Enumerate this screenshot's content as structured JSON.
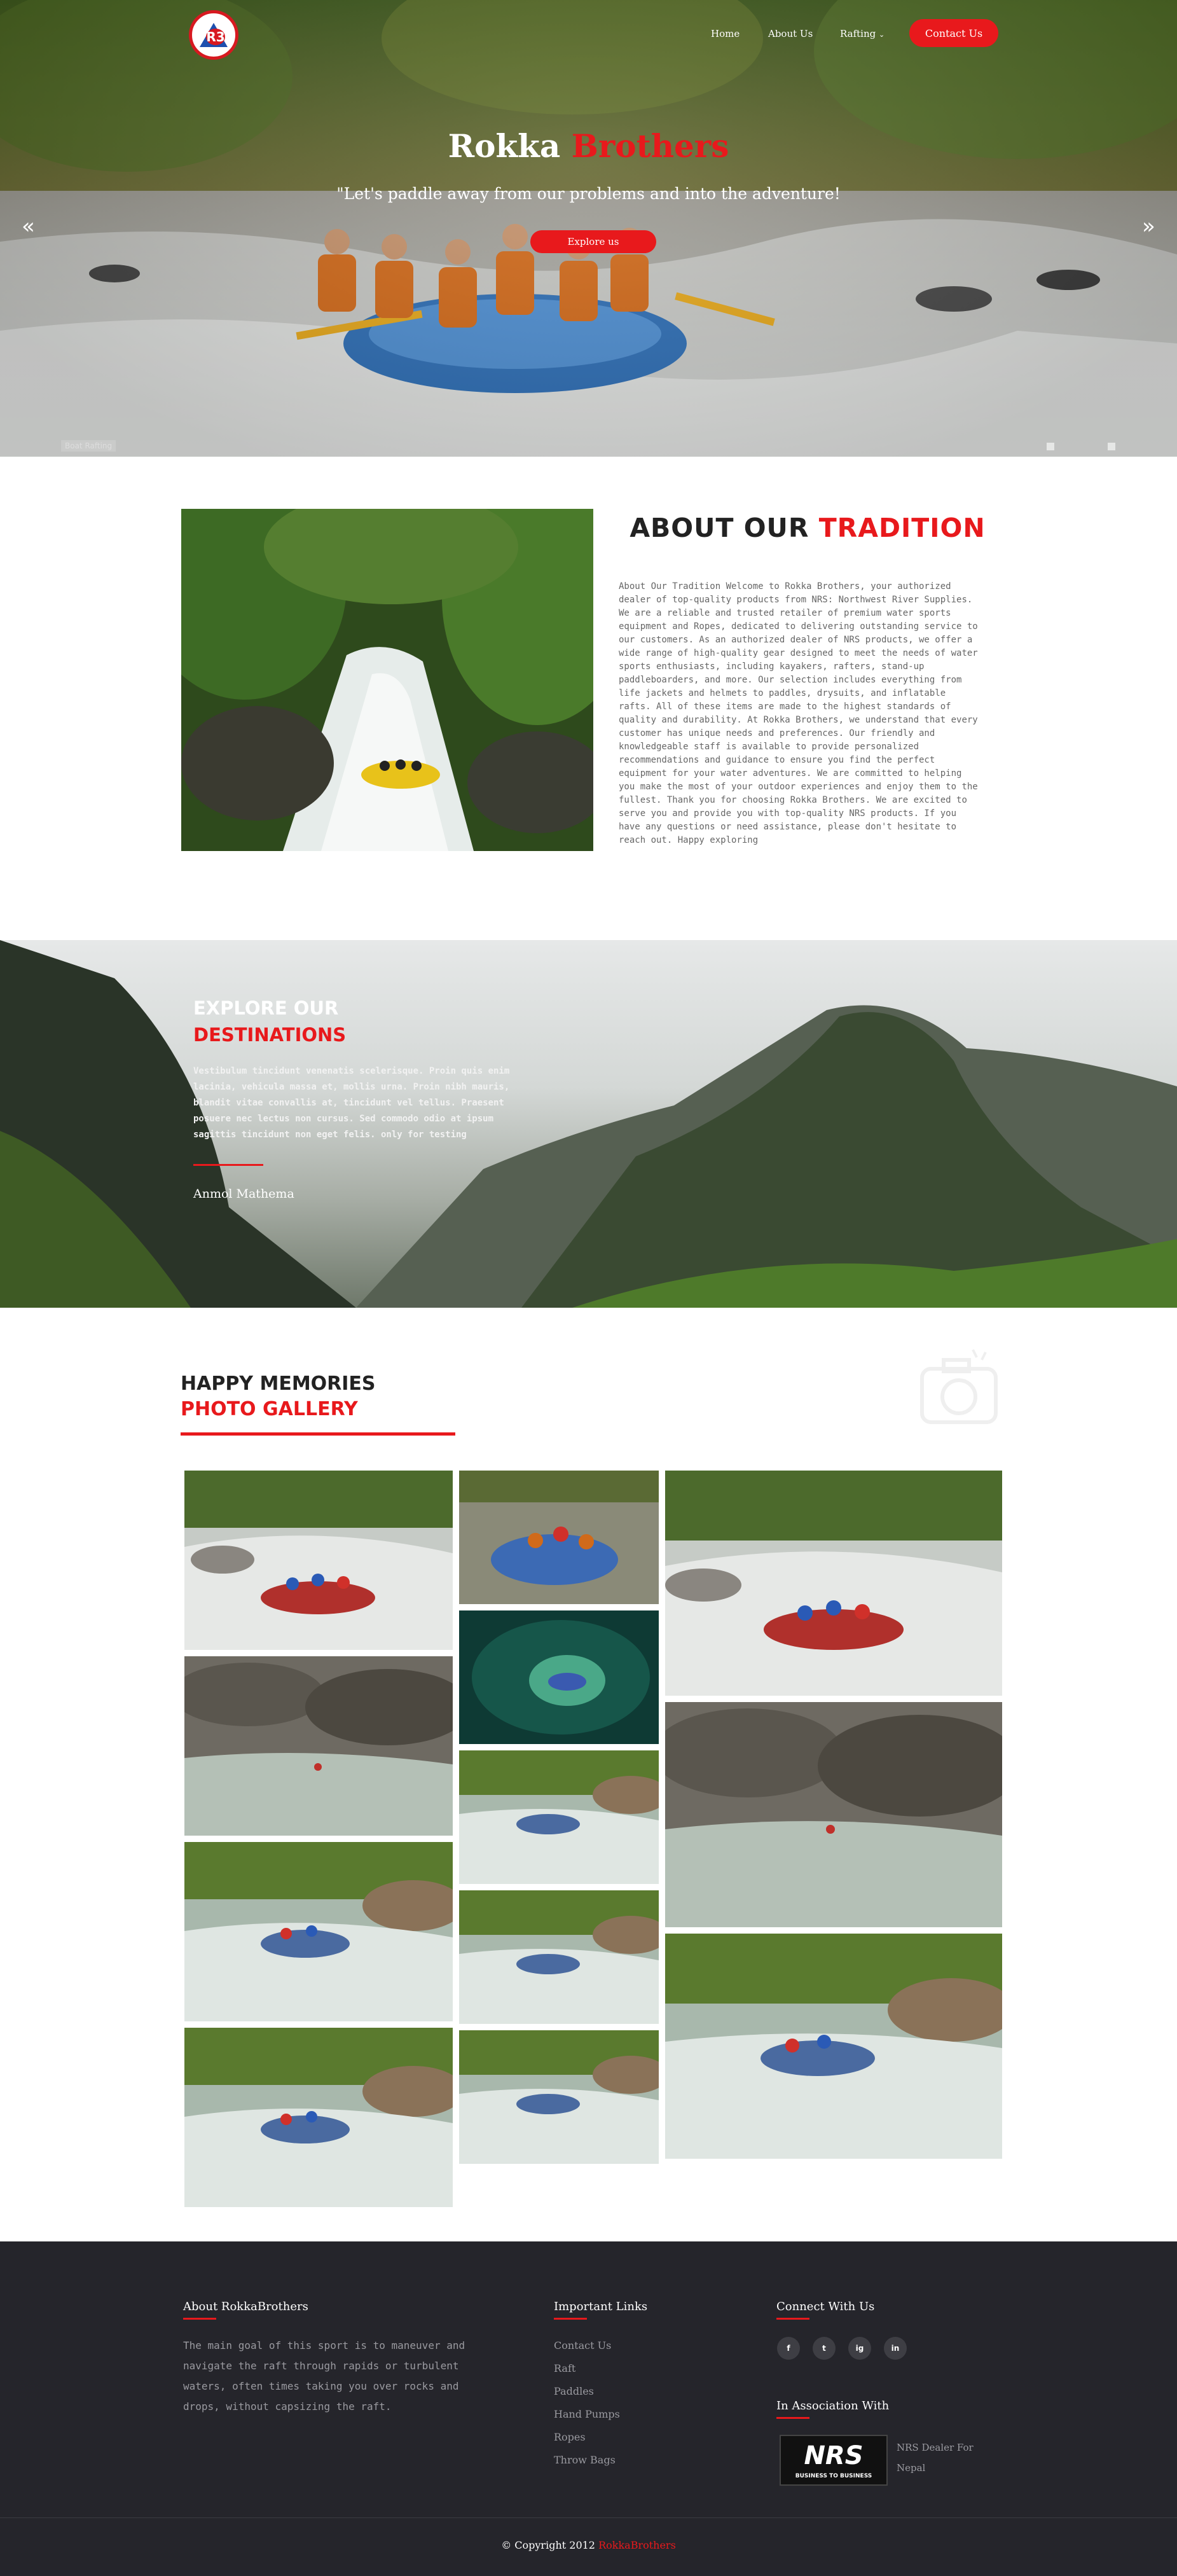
{
  "nav": {
    "items": [
      "Home",
      "About Us",
      "Rafting"
    ],
    "contact_label": "Contact Us"
  },
  "hero": {
    "title_first": "Rokka",
    "title_second": "Brothers",
    "tagline": "\"Let's paddle away from our problems and into the adventure!",
    "explore_label": "Explore us",
    "slide_label": "Boat Rafting"
  },
  "about": {
    "title_first": "ABOUT OUR",
    "title_second": "TRADITION",
    "text": "About Our Tradition Welcome to Rokka Brothers, your authorized dealer of top-quality products from NRS: Northwest River Supplies. We are a reliable and trusted retailer of premium water sports equipment and Ropes, dedicated to delivering outstanding service to our customers. As an authorized dealer of NRS products, we offer a wide range of high-quality gear designed to meet the needs of water sports enthusiasts, including kayakers, rafters, stand-up paddleboarders, and more. Our selection includes everything from life jackets and helmets to paddles, drysuits, and inflatable rafts. All of these items are made to the highest standards of quality and durability. At Rokka Brothers, we understand that every customer has unique needs and preferences. Our friendly and knowledgeable staff is available to provide personalized recommendations and guidance to ensure you find the perfect equipment for your water adventures. We are committed to helping you make the most of your outdoor experiences and enjoy them to the fullest. Thank you for choosing Rokka Brothers. We are excited to serve you and provide you with top-quality NRS products. If you have any questions or need assistance, please don't hesitate to reach out. Happy exploring"
  },
  "explore": {
    "title_first": "EXPLORE OUR",
    "title_second": "DESTINATIONS",
    "text": "Vestibulum tincidunt venenatis scelerisque. Proin quis enim lacinia, vehicula massa et, mollis urna. Proin nibh mauris, blandit vitae convallis at, tincidunt vel tellus. Praesent posuere nec lectus non cursus. Sed commodo odio at ipsum sagittis tincidunt non eget felis. only for testing",
    "author": "Anmol Mathema"
  },
  "gallery": {
    "title_first": "HAPPY MEMORIES",
    "title_second": "PHOTO GALLERY"
  },
  "footer": {
    "about_title": "About RokkaBrothers",
    "about_text": "The main goal of this sport is to maneuver and navigate the raft through rapids or turbulent waters, often times taking you over rocks and drops, without capsizing the raft.",
    "links_title": "Important Links",
    "links": [
      "Contact Us",
      "Raft",
      "Paddles",
      "Hand Pumps",
      "Ropes",
      "Throw Bags"
    ],
    "connect_title": "Connect With Us",
    "social": [
      "f",
      "t",
      "ig",
      "in"
    ],
    "assoc_title": "In Association With",
    "nrs_logo": "NRS",
    "nrs_sub": "BUSINESS TO BUSINESS",
    "assoc_text": "NRS Dealer For Nepal",
    "copyright_prefix": "© Copyright 2012",
    "copyright_brand": "RokkaBrothers"
  },
  "colors": {
    "accent": "#e8191c",
    "footer_bg": "#25252b"
  },
  "icons": [
    "logo",
    "chevron-left-double-icon",
    "chevron-right-double-icon",
    "chevron-down-icon",
    "camera-icon",
    "facebook-icon",
    "twitter-icon",
    "instagram-icon",
    "linkedin-icon"
  ]
}
